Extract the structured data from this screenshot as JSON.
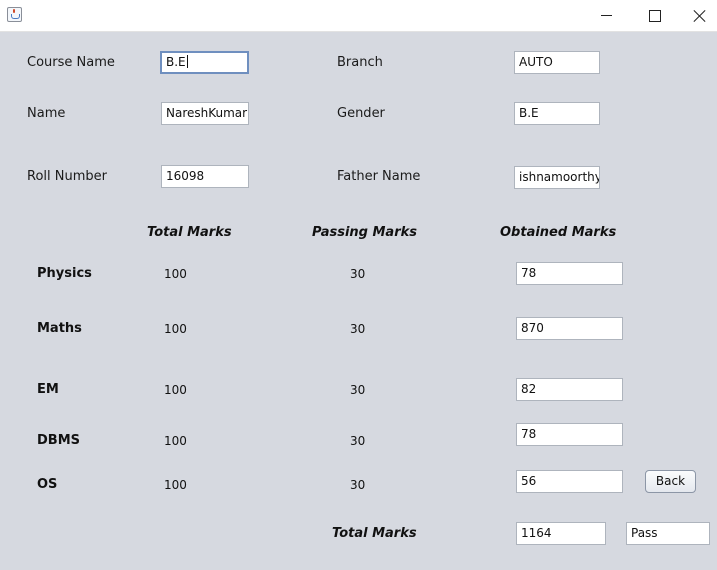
{
  "window": {
    "minimize_glyph": "minimize",
    "maximize_glyph": "maximize",
    "close_glyph": "close"
  },
  "form": {
    "course_name_label": "Course Name",
    "course_name_value": "B.E",
    "branch_label": "Branch",
    "branch_value": "AUTO",
    "name_label": "Name",
    "name_value": "NareshKumar",
    "gender_label": "Gender",
    "gender_value": "B.E",
    "roll_label": "Roll Number",
    "roll_value": "16098",
    "father_label": "Father Name",
    "father_value": "ishnamoorthy"
  },
  "marks": {
    "headers": {
      "total": "Total Marks",
      "passing": "Passing  Marks",
      "obtained": "Obtained Marks"
    },
    "subjects": [
      {
        "name": "Physics",
        "total": "100",
        "passing": "30",
        "obtained": "78"
      },
      {
        "name": "Maths",
        "total": "100",
        "passing": "30",
        "obtained": "870"
      },
      {
        "name": "EM",
        "total": "100",
        "passing": "30",
        "obtained": "82"
      },
      {
        "name": "DBMS",
        "total": "100",
        "passing": "30",
        "obtained": "78"
      },
      {
        "name": "OS",
        "total": "100",
        "passing": "30",
        "obtained": "56"
      }
    ],
    "summary_label": "Total Marks",
    "summary_total": "1164",
    "result": "Pass"
  },
  "buttons": {
    "back_label": "Back"
  }
}
